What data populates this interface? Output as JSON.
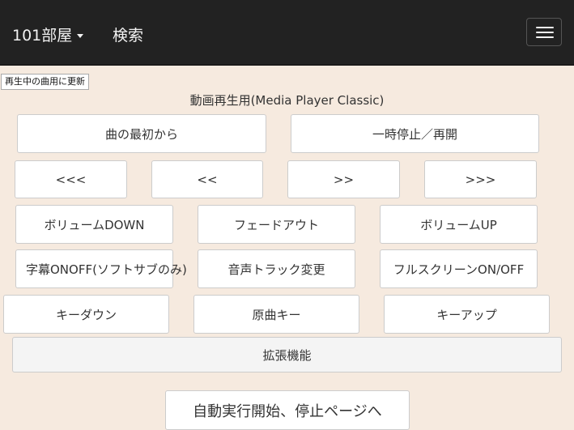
{
  "navbar": {
    "room_label": "101部屋",
    "search_label": "検索"
  },
  "refresh_button": "再生中の曲用に更新",
  "section_title": "動画再生用(Media Player Classic)",
  "playback": {
    "restart": "曲の最初から",
    "pause_resume": "一時停止／再開"
  },
  "seek": {
    "rewind_far": "<<<",
    "rewind": "<<",
    "forward": ">>",
    "forward_far": ">>>"
  },
  "volume": {
    "down": "ボリュームDOWN",
    "fade_out": "フェードアウト",
    "up": "ボリュームUP"
  },
  "track": {
    "subtitle_toggle": "字幕ONOFF(ソフトサブのみ)",
    "audio_track": "音声トラック変更",
    "fullscreen": "フルスクリーンON/OFF"
  },
  "key": {
    "down": "キーダウン",
    "original": "原曲キー",
    "up": "キーアップ"
  },
  "extensions_label": "拡張機能",
  "auto_run_label": "自動実行開始、停止ページへ"
}
